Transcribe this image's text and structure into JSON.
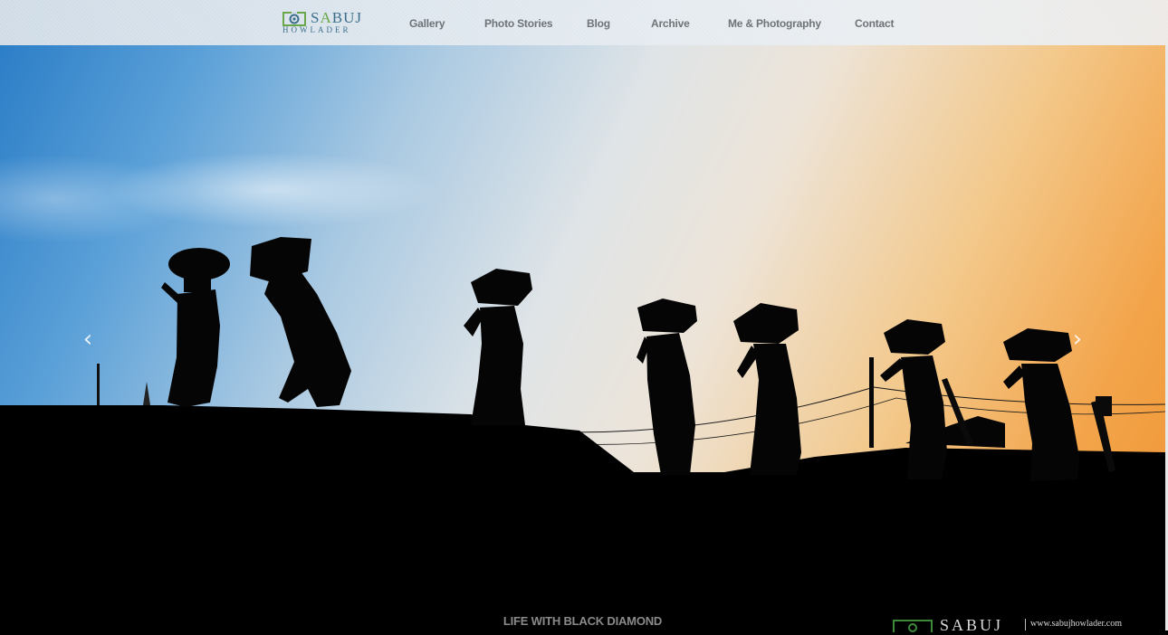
{
  "brand": {
    "name_part1": "S",
    "name_part2": "A",
    "name_part3": "BUJ",
    "tagline": "HOWLADER",
    "accent_blue": "#3c6f8c",
    "accent_green": "#6aa64a"
  },
  "nav": {
    "items": [
      {
        "label": "Gallery"
      },
      {
        "label": "Photo Stories"
      },
      {
        "label": "Blog"
      },
      {
        "label": "Archive"
      },
      {
        "label": "Me & Photography"
      },
      {
        "label": "Contact"
      }
    ]
  },
  "carousel": {
    "prev_icon": "chevron-left-icon",
    "next_icon": "chevron-right-icon",
    "prev_glyph": "‹",
    "next_glyph": "›",
    "caption": "LIFE WITH BLACK DIAMOND"
  },
  "watermark": {
    "name": "SABUJ",
    "url": "www.sabujhowlader.com"
  }
}
